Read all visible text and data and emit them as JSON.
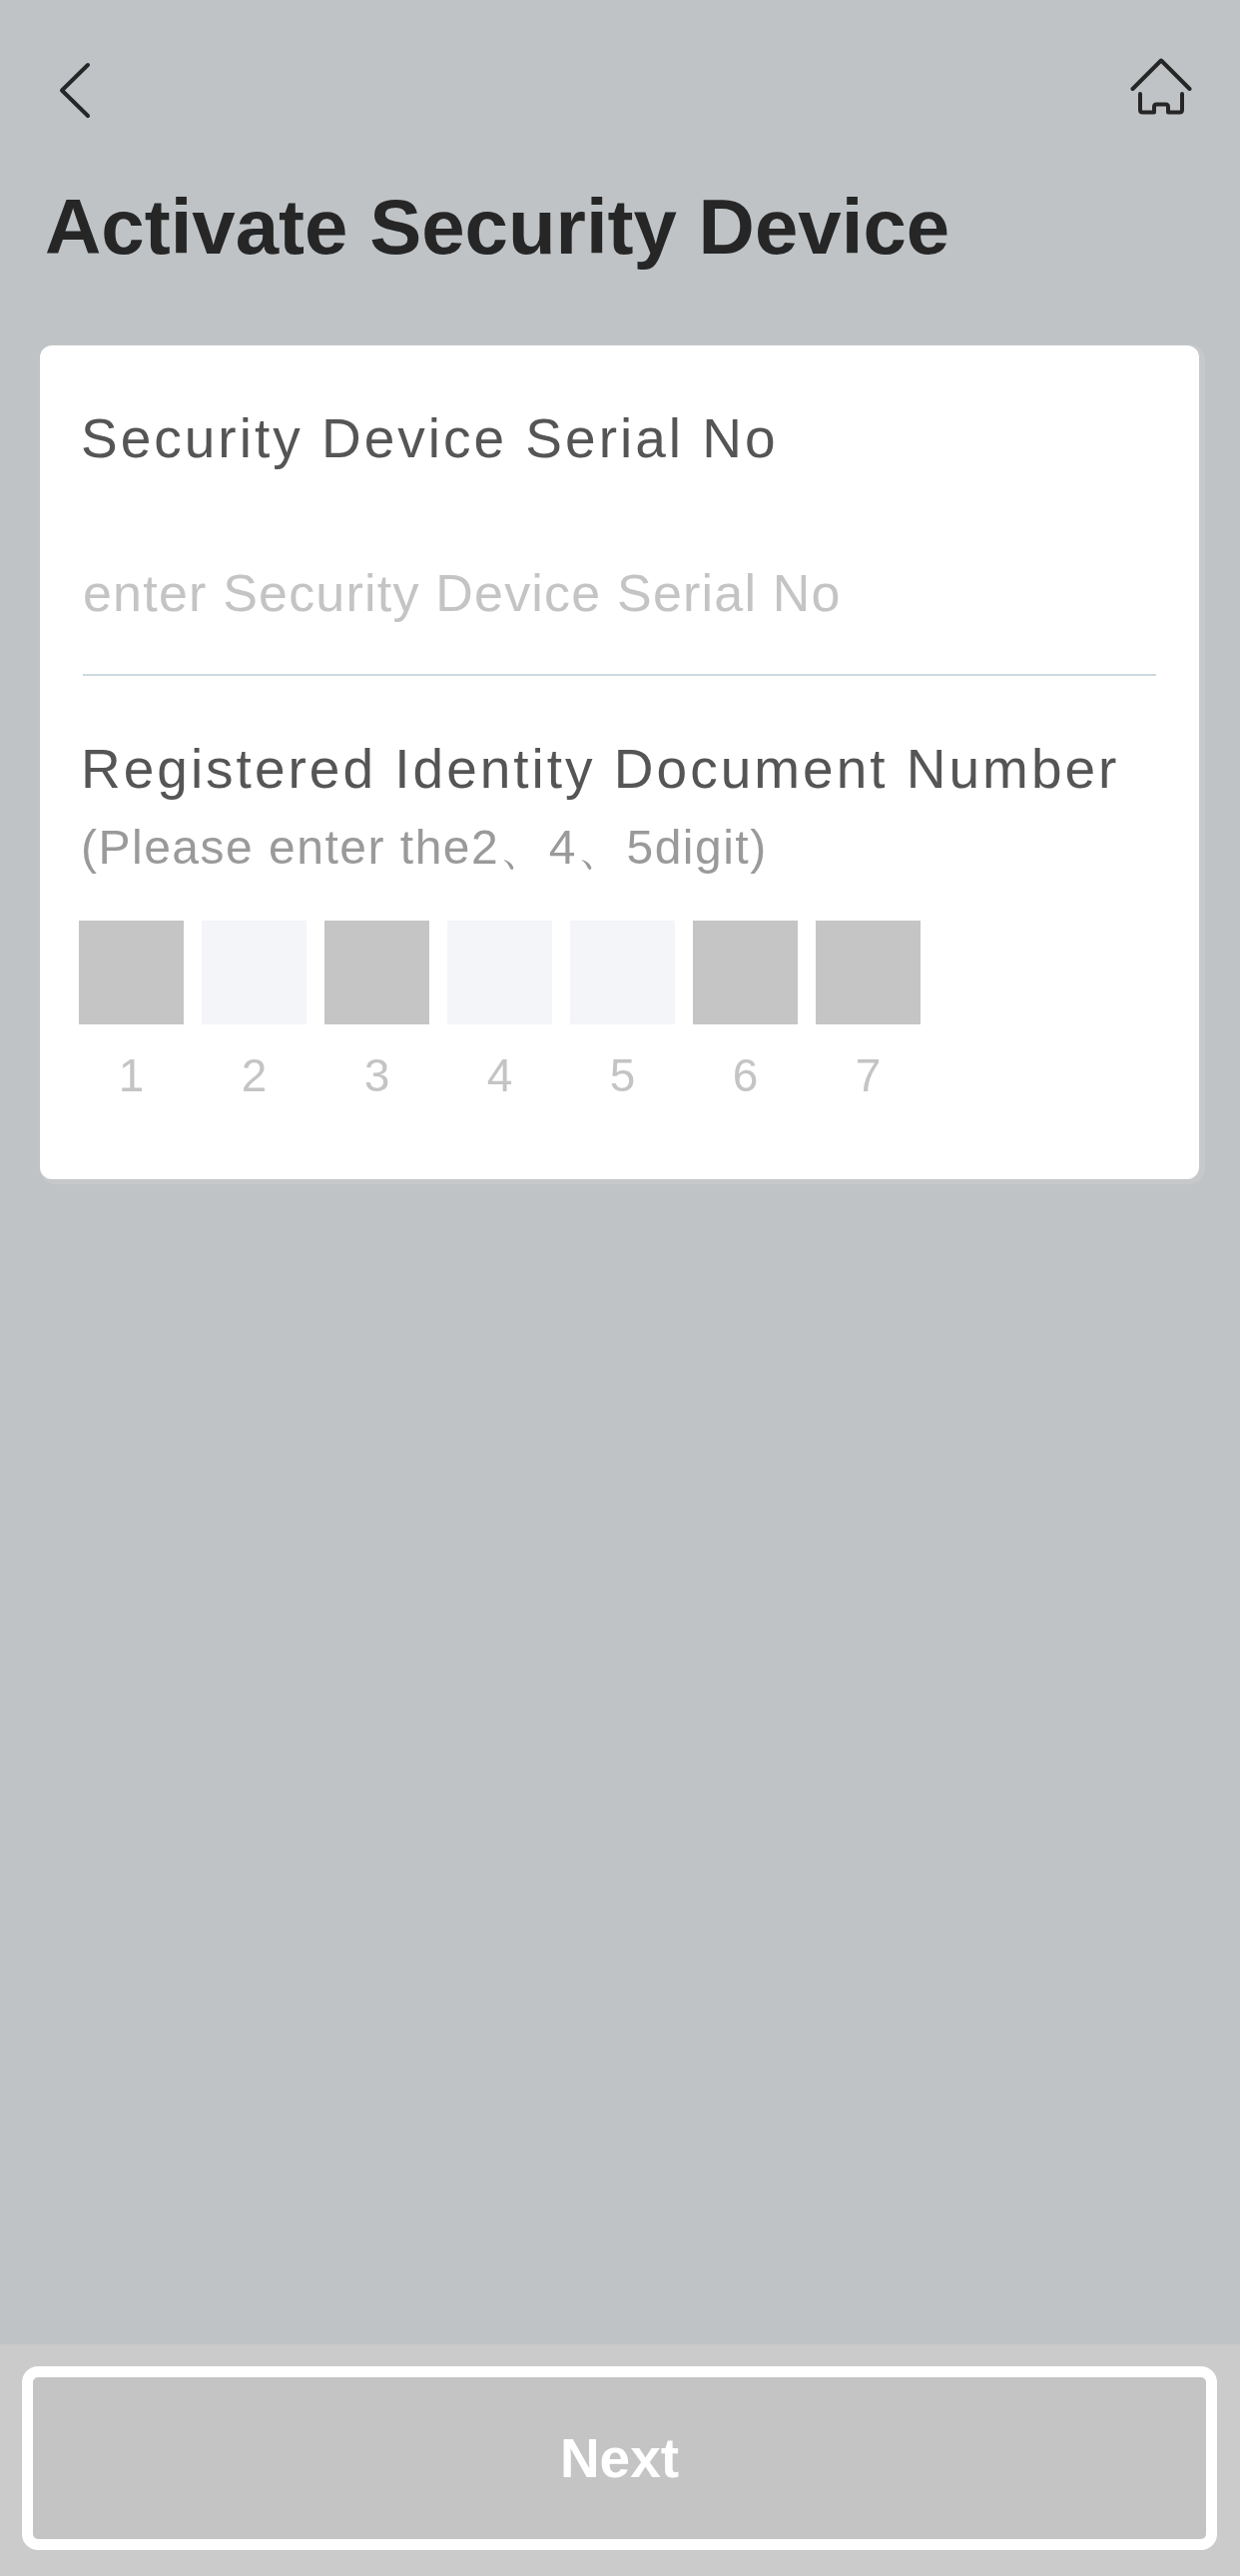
{
  "header": {
    "title": "Activate Security Device"
  },
  "card": {
    "serial_field": {
      "label": "Security Device Serial No",
      "placeholder": "enter Security Device Serial No"
    },
    "identity_field": {
      "label": "Registered Identity Document Number",
      "hint": "(Please enter the2、4、5digit)",
      "digits": [
        {
          "number": "1",
          "disabled": true
        },
        {
          "number": "2",
          "disabled": false
        },
        {
          "number": "3",
          "disabled": true
        },
        {
          "number": "4",
          "disabled": false
        },
        {
          "number": "5",
          "disabled": false
        },
        {
          "number": "6",
          "disabled": true
        },
        {
          "number": "7",
          "disabled": true
        }
      ]
    }
  },
  "footer": {
    "next_button": {
      "label": "Next",
      "disabled": true
    }
  }
}
